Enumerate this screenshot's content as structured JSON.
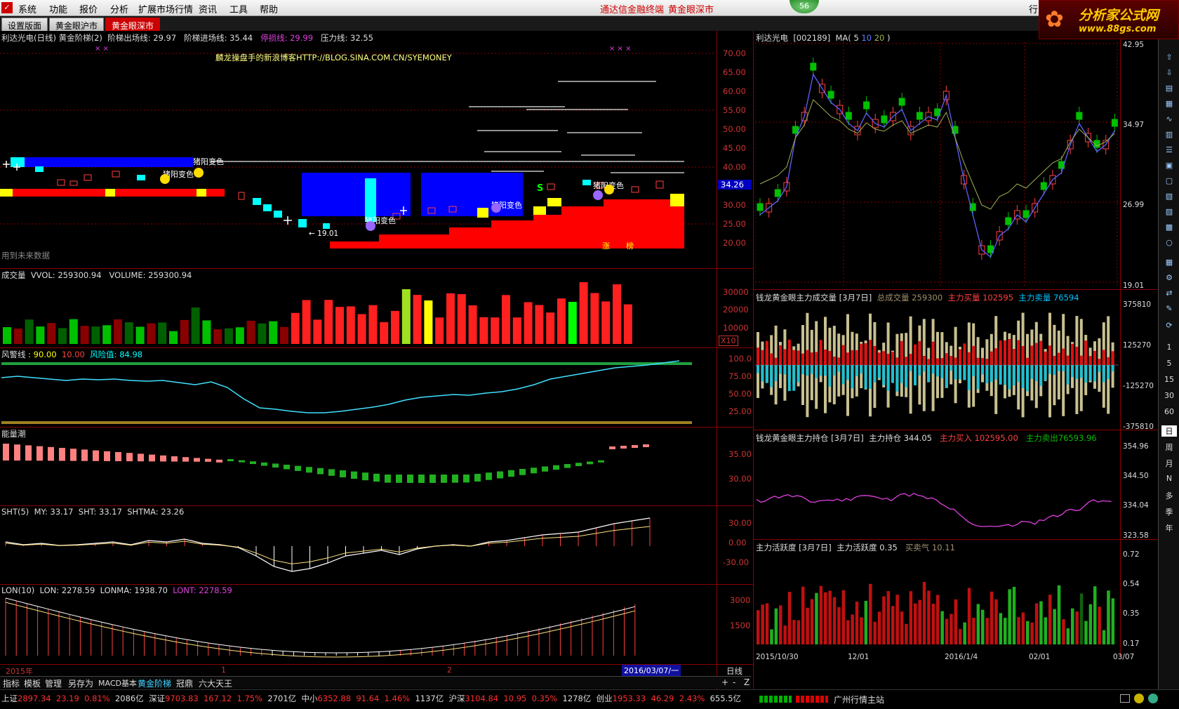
{
  "menu": {
    "items": [
      "系统",
      "功能",
      "报价",
      "分析",
      "扩展市场行情",
      "资讯",
      "工具",
      "帮助"
    ],
    "link1": "通达信金融终端",
    "link2": "黄金眼深市",
    "badge": "56",
    "right_tab": "行"
  },
  "brand": {
    "title": "分析家公式网",
    "url": "www.88gs.com"
  },
  "tabs": [
    "设置版面",
    "黄金眼沪市",
    "黄金眼深市"
  ],
  "left": {
    "main_title": {
      "name": "利达光电(日线) 黄金阶梯(2)",
      "l1": "阶梯出场线: 29.97",
      "l2": "阶梯进场线: 35.44",
      "l3": "停损线: 29.99",
      "l4": "压力线: 32.55"
    },
    "blog": "麟龙操盘手的新浪博客HTTP://BLOG.SINA.COM.CN/SYEMONEY",
    "note": "用到未来数据",
    "ann": [
      "猪阳变色",
      "猪阳变色",
      "猪阳变色",
      "猪阳变色",
      "猪阳变色"
    ],
    "low_label": "← 19.01",
    "price_tag": "34.26",
    "zhang": "涨",
    "bang": "榜",
    "s_mark": "S",
    "main_axis": [
      "70.00",
      "65.00",
      "60.00",
      "55.00",
      "50.00",
      "45.00",
      "40.00",
      "35.00",
      "30.00",
      "25.00",
      "20.00"
    ],
    "vol_title": {
      "a": "成交量",
      "b": "VVOL: 259300.94",
      "c": "VOLUME: 259300.94"
    },
    "vol_axis": [
      "30000",
      "20000",
      "10000"
    ],
    "vol_unit": "X10",
    "risk_title": {
      "a": "风警线",
      "b": ": 90.00",
      "c": "10.00",
      "d": "风险值: 84.98"
    },
    "risk_axis": [
      "100.0",
      "75.00",
      "50.00",
      "25.00"
    ],
    "energy_title": "能量潮",
    "energy_axis": [
      "35.00",
      "30.00"
    ],
    "sht_title": {
      "a": "SHT(5)",
      "b": "MY: 33.17",
      "c": "SHT: 33.17",
      "d": "SHTMA: 23.26"
    },
    "sht_axis": [
      "30.00",
      "0.00",
      "-30.00"
    ],
    "lon_title": {
      "a": "LON(10)",
      "b": "LON: 2278.59",
      "c": "LONMA: 1938.70",
      "d": "LONT: 2278.59"
    },
    "lon_axis": [
      "3000",
      "1500"
    ],
    "xaxis": {
      "y2015": "2015年",
      "m1": "1",
      "m2": "2",
      "cursor": "2016/03/07/一",
      "period": "日线"
    }
  },
  "right": {
    "k_title": {
      "name": "利达光电",
      "code": "[002189]",
      "ma": "MA(",
      "m5": "5",
      "m10": "10",
      "m20": "20",
      ")": ")"
    },
    "k_axis": [
      "42.95",
      "34.97",
      "26.99",
      "19.01"
    ],
    "vol_title": {
      "a": "钱龙黄金眼主力成交量 [3月7日]",
      "b": "总成交量 259300",
      "c": "主力买量",
      "d": "102595",
      "e": "主力卖量",
      "f": "76594"
    },
    "vol_axis": [
      "375810",
      "125270",
      "-125270",
      "-375810"
    ],
    "hold_title": {
      "a": "钱龙黄金眼主力持仓 [3月7日]",
      "b": "主力持仓 344.05",
      "c": "主力买入 102595.00",
      "d": "主力卖出76593.96"
    },
    "hold_axis": [
      "354.96",
      "344.50",
      "334.04",
      "323.58"
    ],
    "act_title": {
      "a": "主力活跃度 [3月7日]",
      "b": "主力活跃度 0.35",
      "c": "买卖气 10.11"
    },
    "act_axis": [
      "0.72",
      "0.54",
      "0.35",
      "0.17"
    ],
    "dates": [
      "2015/10/30",
      "12/01",
      "2016/1/4",
      "02/01",
      "03/07"
    ]
  },
  "bottom_tabs": [
    "指标",
    "模板",
    "管理",
    "另存为",
    "MACD基本",
    "黄金阶梯",
    "冠鼎",
    "六大天王"
  ],
  "bottom_ctrl": [
    "+",
    "-",
    "Z"
  ],
  "status": {
    "items": [
      {
        "name": "上证",
        "value": "2897.34",
        "chg": "23.19",
        "pct": "0.81%",
        "amt": "2086亿"
      },
      {
        "name": "深证",
        "value": "9703.83",
        "chg": "167.12",
        "pct": "1.75%",
        "amt": "2701亿"
      },
      {
        "name": "中小",
        "value": "6352.88",
        "chg": "91.64",
        "pct": "1.46%",
        "amt": "1137亿"
      },
      {
        "name": "沪深",
        "value": "3104.84",
        "chg": "10.95",
        "pct": "0.35%",
        "amt": "1278亿"
      },
      {
        "name": "创业",
        "value": "1953.33",
        "chg": "46.29",
        "pct": "2.43%",
        "amt": "655.5亿"
      }
    ],
    "server": "广州行情主站"
  },
  "toolbar": {
    "periods": [
      "1",
      "5",
      "15",
      "30",
      "60",
      "日",
      "周",
      "月",
      "N",
      "多",
      "季",
      "年"
    ]
  },
  "colors": {
    "up": "#ff2020",
    "down": "#00c000",
    "grid": "#8a0000",
    "cyan": "#00ffff",
    "blue": "#0000ff",
    "yellow": "#ffff00"
  }
}
